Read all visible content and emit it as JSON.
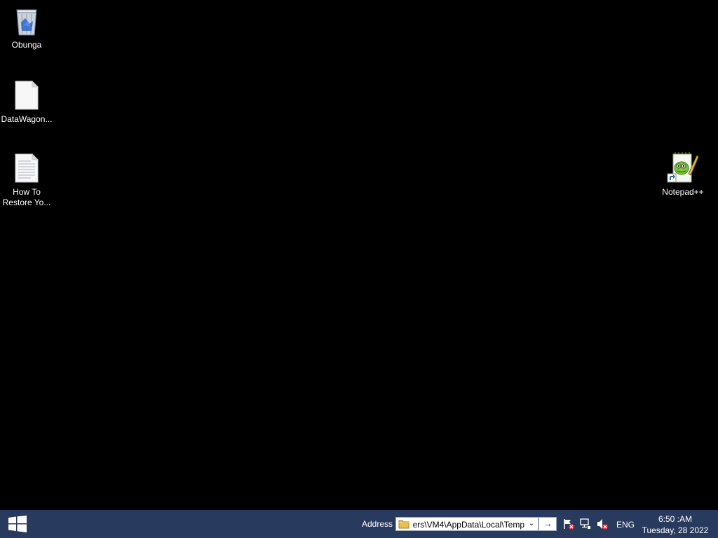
{
  "desktop": {
    "icons": [
      {
        "name": "recycle-bin",
        "label": "Obunga",
        "icon": "recycle-bin-icon"
      },
      {
        "name": "file",
        "label": "DataWagon...",
        "icon": "blank-file-icon"
      },
      {
        "name": "text-file",
        "label": "How To\nRestore Yo...",
        "icon": "text-document-icon"
      },
      {
        "name": "notepadpp-shortcut",
        "label": "Notepad++",
        "icon": "notepadpp-icon"
      }
    ]
  },
  "taskbar": {
    "start_icon": "windows-logo-icon",
    "address_label": "Address",
    "address_value": "ers\\VM4\\AppData\\Local\\Temp",
    "go_icon": "arrow-right-icon",
    "tray": {
      "icons": [
        "action-center-flag-icon",
        "network-icon",
        "volume-muted-icon"
      ],
      "language": "ENG"
    },
    "clock": {
      "time": "6:50 :AM",
      "date": "Tuesday, 28 2022"
    }
  },
  "colors": {
    "desktop_background": "#000000",
    "taskbar_background": "#283a5e"
  }
}
